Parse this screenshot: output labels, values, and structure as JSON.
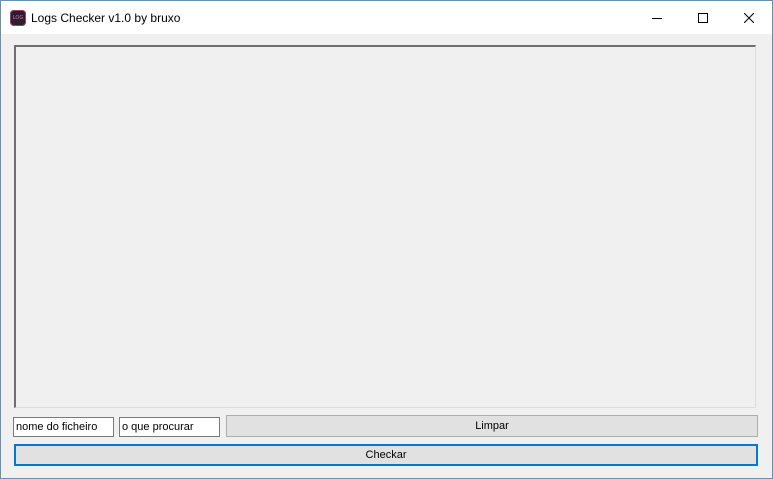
{
  "window": {
    "title": "Logs Checker v1.0 by bruxo",
    "icon": "app-logo-icon",
    "icon_glyph": "LOG",
    "accent_color": "#0078d7",
    "controls": {
      "minimize": "minimize-icon",
      "maximize": "maximize-icon",
      "close": "close-icon"
    }
  },
  "main": {
    "output_text": ""
  },
  "inputs": {
    "filename_value": "nome do ficheiro",
    "search_value": "o que procurar"
  },
  "buttons": {
    "clear_label": "Limpar",
    "check_label": "Checkar"
  }
}
